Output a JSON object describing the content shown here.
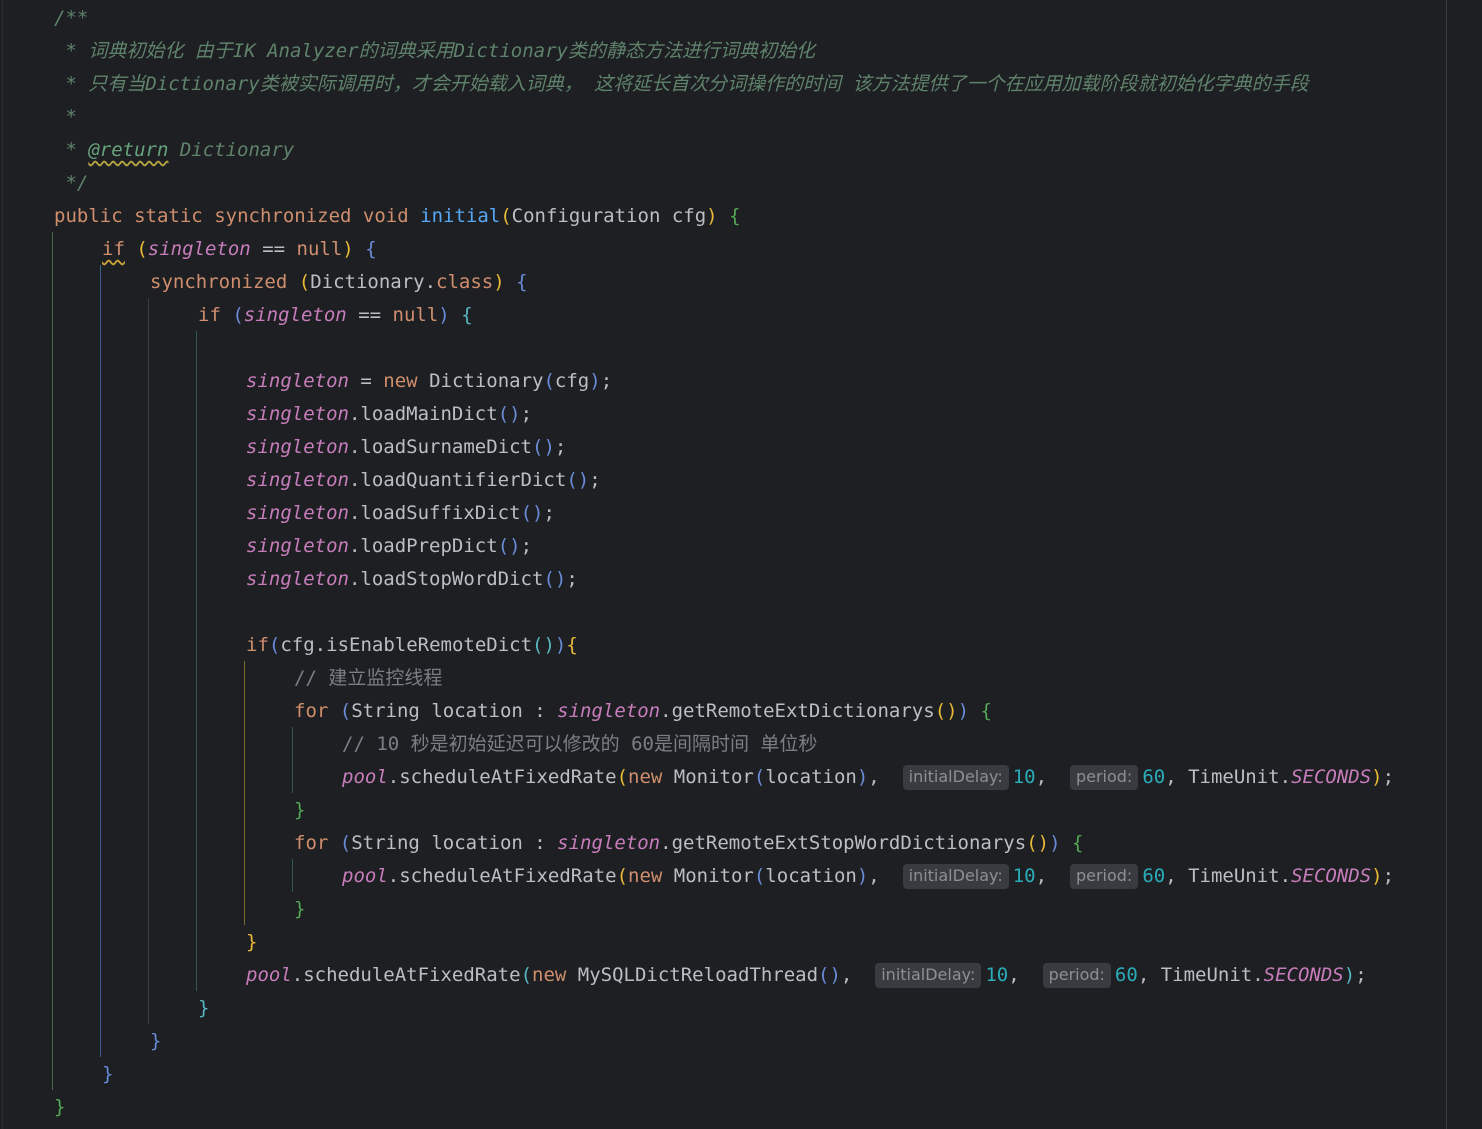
{
  "comment": {
    "open": "/**",
    "line1": " * 词典初始化 由于IK Analyzer的词典采用Dictionary类的静态方法进行词典初始化",
    "line2": " * 只有当Dictionary类被实际调用时，才会开始载入词典， 这将延长首次分词操作的时间 该方法提供了一个在应用加载阶段就初始化字典的手段",
    "line3": " *",
    "line4_prefix": " * ",
    "return_tag": "@return",
    "return_type": " Dictionary",
    "close": " */"
  },
  "keywords": {
    "public": "public",
    "static": "static",
    "synchronized": "synchronized",
    "void": "void",
    "if": "if",
    "null": "null",
    "new": "new",
    "for": "for",
    "class": "class"
  },
  "identifiers": {
    "method_name": "initial",
    "config_type": "Configuration",
    "param": "cfg",
    "singleton": "singleton",
    "dictionary": "Dictionary",
    "pool": "pool",
    "string_type": "String",
    "location": "location",
    "monitor": "Monitor",
    "mysql_thread": "MySQLDictReloadThread",
    "timeunit": "TimeUnit",
    "seconds": "SECONDS"
  },
  "methods": {
    "load_main": "loadMainDict",
    "load_surname": "loadSurnameDict",
    "load_quantifier": "loadQuantifierDict",
    "load_suffix": "loadSuffixDict",
    "load_prep": "loadPrepDict",
    "load_stopword": "loadStopWordDict",
    "is_enable_remote": "isEnableRemoteDict",
    "get_remote_ext": "getRemoteExtDictionarys",
    "get_remote_ext_stop": "getRemoteExtStopWordDictionarys",
    "schedule": "scheduleAtFixedRate"
  },
  "inline_comments": {
    "build_monitor": "// 建立监控线程",
    "delay_note": "// 10 秒是初始延迟可以修改的 60是间隔时间 单位秒"
  },
  "hints": {
    "initial_delay": "initialDelay:",
    "period": "period:"
  },
  "numbers": {
    "delay": "10",
    "period": "60"
  }
}
